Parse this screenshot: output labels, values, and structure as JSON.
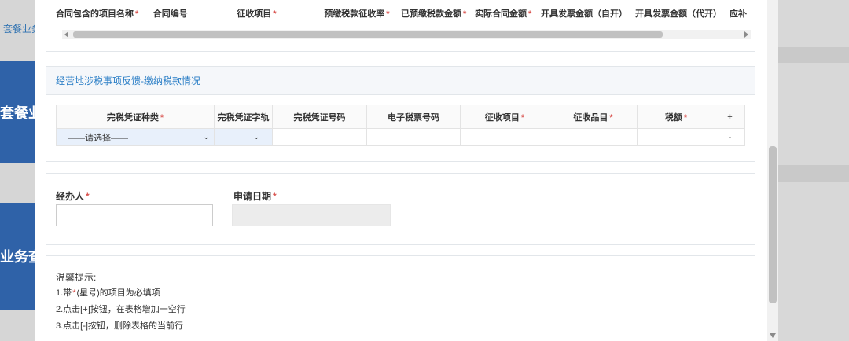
{
  "background": {
    "left_link": "套餐业务",
    "left_tile_1": "套餐业务",
    "left_tile_2": "业务查询"
  },
  "top_table": {
    "columns": [
      {
        "label": "合同包含的项目名称",
        "required": true
      },
      {
        "label": "合同编号",
        "required": false
      },
      {
        "label": "征收项目",
        "required": true
      },
      {
        "label": "预缴税款征收率",
        "required": true
      },
      {
        "label": "已预缴税款金额",
        "required": true
      },
      {
        "label": "实际合同金额",
        "required": true
      },
      {
        "label": "开具发票金额（自开）",
        "required": false
      },
      {
        "label": "开具发票金额（代开）",
        "required": false
      },
      {
        "label": "应补",
        "required": false
      }
    ],
    "required_mark": "*"
  },
  "tax_section": {
    "title": "经营地涉税事项反馈-缴纳税款情况",
    "columns": [
      {
        "label": "完税凭证种类",
        "required": true
      },
      {
        "label": "完税凭证字轨",
        "required": false
      },
      {
        "label": "完税凭证号码",
        "required": false
      },
      {
        "label": "电子税票号码",
        "required": false
      },
      {
        "label": "征收项目",
        "required": true
      },
      {
        "label": "征收品目",
        "required": true
      },
      {
        "label": "税额",
        "required": true
      }
    ],
    "add_row_label": "+",
    "remove_row_label": "-",
    "row": {
      "voucher_type_select": "——请选择——",
      "voucher_track_select": ""
    },
    "required_mark": "*"
  },
  "person_section": {
    "handler_label": "经办人",
    "handler_value": "",
    "apply_date_label": "申请日期",
    "required_mark": "*"
  },
  "tips": {
    "title": "温馨提示:",
    "lines": [
      {
        "prefix": "1.带",
        "mark": "*",
        "suffix": "(星号)的项目为必填项"
      },
      {
        "text": "2.点击[+]按钮，在表格增加一空行"
      },
      {
        "text": "3.点击[-]按钮，删除表格的当前行"
      }
    ]
  },
  "colors": {
    "accent_blue": "#2a7ec6",
    "required_red": "#d9534f",
    "bg_tile_blue": "#2f62a8"
  }
}
